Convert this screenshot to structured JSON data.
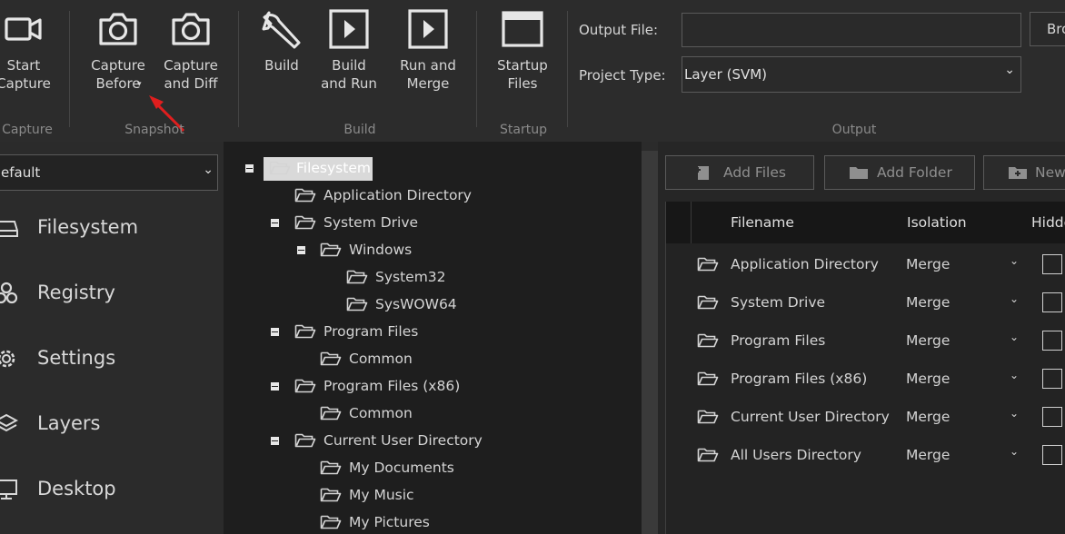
{
  "ribbon": {
    "buttons": {
      "start_capture": "Start\nCapture",
      "capture_before": "Capture\nBefore",
      "capture_and_diff": "Capture\nand Diff",
      "build": "Build",
      "build_and_run": "Build\nand Run",
      "run_and_merge": "Run and\nMerge",
      "startup_files": "Startup\nFiles"
    },
    "groups": {
      "capture": "Capture",
      "snapshot": "Snapshot",
      "build": "Build",
      "startup": "Startup",
      "output": "Output"
    },
    "output": {
      "output_file_label": "Output File:",
      "output_file_value": "",
      "project_type_label": "Project Type:",
      "project_type_value": "Layer (SVM)",
      "browse_label": "Bro"
    }
  },
  "sidebar": {
    "dropdown_value": "efault",
    "items": [
      {
        "label": "Filesystem",
        "icon": "drive-icon"
      },
      {
        "label": "Registry",
        "icon": "registry-icon"
      },
      {
        "label": "Settings",
        "icon": "gear-icon"
      },
      {
        "label": "Layers",
        "icon": "layers-icon"
      },
      {
        "label": "Desktop",
        "icon": "monitor-icon"
      }
    ]
  },
  "tree": {
    "nodes": [
      {
        "label": "Filesystem",
        "selected": true
      },
      {
        "label": "Application Directory"
      },
      {
        "label": "System Drive"
      },
      {
        "label": "Windows"
      },
      {
        "label": "System32"
      },
      {
        "label": "SysWOW64"
      },
      {
        "label": "Program Files"
      },
      {
        "label": "Common"
      },
      {
        "label": "Program Files (x86)"
      },
      {
        "label": "Common"
      },
      {
        "label": "Current User Directory"
      },
      {
        "label": "My Documents"
      },
      {
        "label": "My Music"
      },
      {
        "label": "My Pictures"
      }
    ]
  },
  "files": {
    "toolbar": {
      "add_files": "Add Files",
      "add_folder": "Add Folder",
      "new": "New"
    },
    "columns": {
      "filename": "Filename",
      "isolation": "Isolation",
      "hidden": "Hidde"
    },
    "rows": [
      {
        "name": "Application Directory",
        "isolation": "Merge"
      },
      {
        "name": "System Drive",
        "isolation": "Merge"
      },
      {
        "name": "Program Files",
        "isolation": "Merge"
      },
      {
        "name": "Program Files (x86)",
        "isolation": "Merge"
      },
      {
        "name": "Current User Directory",
        "isolation": "Merge"
      },
      {
        "name": "All Users Directory",
        "isolation": "Merge"
      }
    ]
  },
  "colors": {
    "background": "#2b2b2b",
    "tree_background": "#1e1e1e",
    "selection": "#d9d9d9",
    "annotation_arrow": "#e01e1e"
  }
}
